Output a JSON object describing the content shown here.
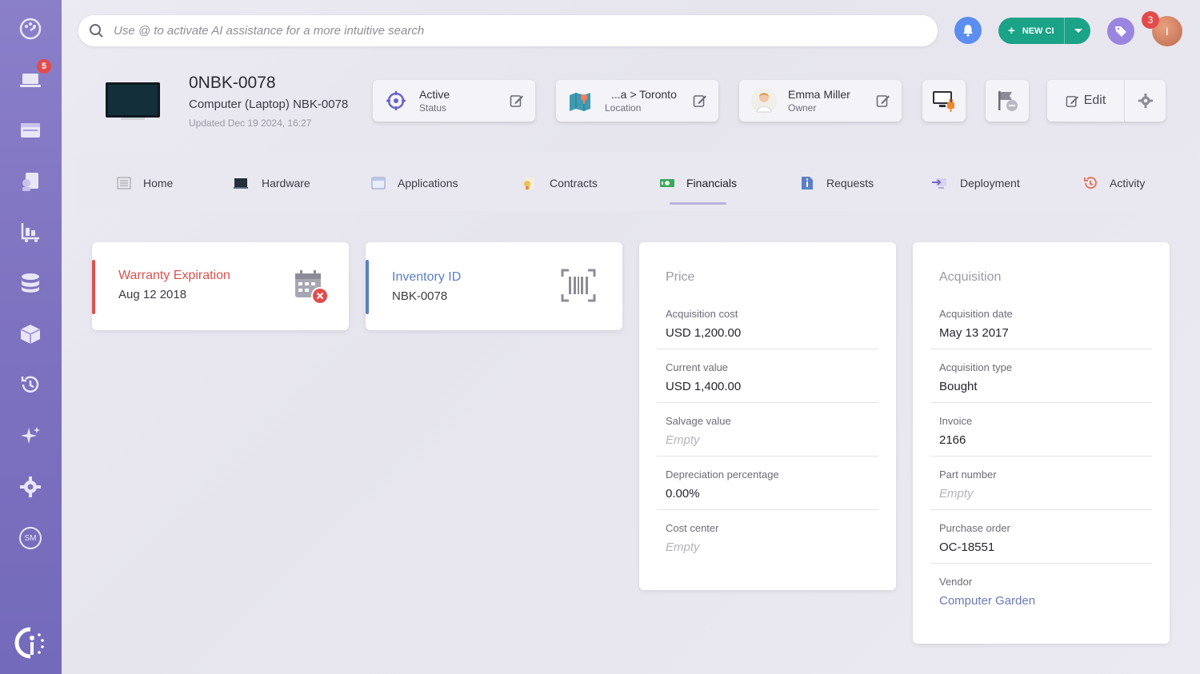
{
  "sidebar": {
    "items": [
      {
        "name": "dashboard-icon"
      },
      {
        "name": "laptop-icon",
        "badge": "5"
      },
      {
        "name": "window-icon"
      },
      {
        "name": "user-document-icon"
      },
      {
        "name": "inventory-cart-icon"
      },
      {
        "name": "database-icon"
      },
      {
        "name": "box-icon"
      },
      {
        "name": "history-icon"
      },
      {
        "name": "sparkle-icon"
      },
      {
        "name": "gear-icon"
      },
      {
        "name": "sm-icon",
        "label": "SM"
      }
    ]
  },
  "search": {
    "placeholder": "Use @ to activate AI assistance for a more intuitive search"
  },
  "topbar": {
    "new_ci_label": "NEW CI",
    "notifications_badge": "3",
    "avatar_initial": "I"
  },
  "ci": {
    "title": "0NBK-0078",
    "subtitle": "Computer (Laptop) NBK-0078",
    "updated": "Updated Dec 19 2024, 16:27"
  },
  "header_cards": {
    "status": {
      "value": "Active",
      "label": "Status"
    },
    "location": {
      "value": "...a > Toronto",
      "label": "Location"
    },
    "owner": {
      "value": "Emma Miller",
      "label": "Owner"
    }
  },
  "edit_label": "Edit",
  "tabs": [
    {
      "label": "Home"
    },
    {
      "label": "Hardware"
    },
    {
      "label": "Applications"
    },
    {
      "label": "Contracts"
    },
    {
      "label": "Financials",
      "active": true
    },
    {
      "label": "Requests"
    },
    {
      "label": "Deployment"
    },
    {
      "label": "Activity"
    }
  ],
  "warranty": {
    "title": "Warranty Expiration",
    "value": "Aug 12 2018",
    "color": "#d9534f"
  },
  "inventory": {
    "title": "Inventory ID",
    "value": "NBK-0078",
    "color": "#5b7fc4"
  },
  "price": {
    "title": "Price",
    "fields": [
      {
        "label": "Acquisition cost",
        "value": "USD 1,200.00"
      },
      {
        "label": "Current value",
        "value": "USD 1,400.00"
      },
      {
        "label": "Salvage value",
        "value": "Empty"
      },
      {
        "label": "Depreciation percentage",
        "value": "0.00%"
      },
      {
        "label": "Cost center",
        "value": "Empty"
      }
    ]
  },
  "acquisition": {
    "title": "Acquisition",
    "fields": [
      {
        "label": "Acquisition date",
        "value": "May 13 2017"
      },
      {
        "label": "Acquisition type",
        "value": "Bought"
      },
      {
        "label": "Invoice",
        "value": "2166"
      },
      {
        "label": "Part number",
        "value": "Empty"
      },
      {
        "label": "Purchase order",
        "value": "OC-18551"
      },
      {
        "label": "Vendor",
        "value": "Computer Garden"
      }
    ]
  },
  "colors": {
    "sidebar": "#7d72bf",
    "accent_green": "#1aa386",
    "bell_blue": "#5b8ef0",
    "tag_purple": "#9a86e0",
    "badge_red": "#e34b4b"
  }
}
